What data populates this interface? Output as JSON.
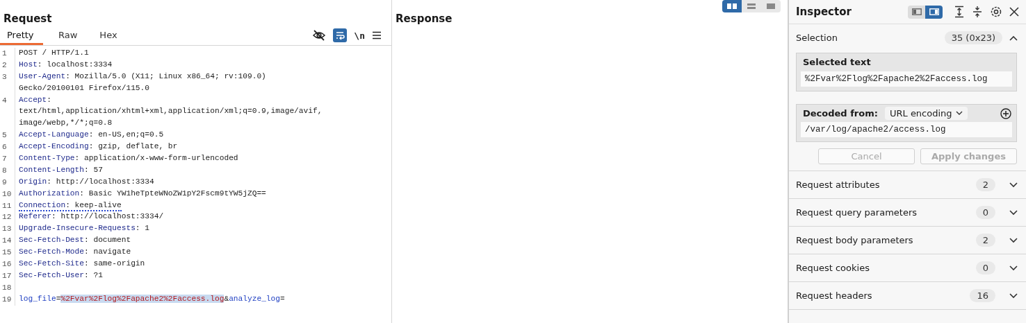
{
  "request": {
    "title": "Request",
    "tabs": [
      {
        "label": "Pretty",
        "selected": true
      },
      {
        "label": "Raw",
        "selected": false
      },
      {
        "label": "Hex",
        "selected": false
      }
    ],
    "toolbar": {
      "hide_nonprinting": false,
      "wrap_lines": true,
      "newline_label": "\\n"
    },
    "lines": [
      {
        "number": "1",
        "underlined": false,
        "segments": [
          {
            "kind": "text",
            "text": "POST / HTTP/1.1"
          }
        ]
      },
      {
        "number": "2",
        "underlined": false,
        "segments": [
          {
            "kind": "header",
            "text": "Host"
          },
          {
            "kind": "text",
            "text": ": localhost:3334"
          }
        ]
      },
      {
        "number": "3",
        "underlined": false,
        "segments": [
          {
            "kind": "header",
            "text": "User-Agent"
          },
          {
            "kind": "text",
            "text": ": Mozilla/5.0 (X11; Linux x86_64; rv:109.0)"
          }
        ]
      },
      {
        "underlined": false,
        "segments": [
          {
            "kind": "text",
            "text": "Gecko/20100101 Firefox/115.0"
          }
        ]
      },
      {
        "number": "4",
        "underlined": false,
        "segments": [
          {
            "kind": "header",
            "text": "Accept"
          },
          {
            "kind": "text",
            "text": ":"
          }
        ]
      },
      {
        "underlined": false,
        "segments": [
          {
            "kind": "text",
            "text": "text/html,application/xhtml+xml,application/xml;q=0.9,image/avif,"
          }
        ]
      },
      {
        "underlined": false,
        "segments": [
          {
            "kind": "text",
            "text": "image/webp,*/*;q=0.8"
          }
        ]
      },
      {
        "number": "5",
        "underlined": false,
        "segments": [
          {
            "kind": "header",
            "text": "Accept-Language"
          },
          {
            "kind": "text",
            "text": ": en-US,en;q=0.5"
          }
        ]
      },
      {
        "number": "6",
        "underlined": false,
        "segments": [
          {
            "kind": "header",
            "text": "Accept-Encoding"
          },
          {
            "kind": "text",
            "text": ": gzip, deflate, br"
          }
        ]
      },
      {
        "number": "7",
        "underlined": false,
        "segments": [
          {
            "kind": "header",
            "text": "Content-Type"
          },
          {
            "kind": "text",
            "text": ": application/x-www-form-urlencoded"
          }
        ]
      },
      {
        "number": "8",
        "underlined": false,
        "segments": [
          {
            "kind": "header",
            "text": "Content-Length"
          },
          {
            "kind": "text",
            "text": ": 57"
          }
        ]
      },
      {
        "number": "9",
        "underlined": false,
        "segments": [
          {
            "kind": "header",
            "text": "Origin"
          },
          {
            "kind": "text",
            "text": ": http://localhost:3334"
          }
        ]
      },
      {
        "number": "10",
        "underlined": false,
        "segments": [
          {
            "kind": "header",
            "text": "Authorization"
          },
          {
            "kind": "text",
            "text": ": Basic YW1heTpteWNoZW1pY2Fscm9tYW5jZQ=="
          }
        ]
      },
      {
        "number": "11",
        "underlined": true,
        "segments": [
          {
            "kind": "header",
            "text": "Connection"
          },
          {
            "kind": "text",
            "text": ": keep-alive"
          }
        ]
      },
      {
        "number": "12",
        "underlined": false,
        "segments": [
          {
            "kind": "header",
            "text": "Referer"
          },
          {
            "kind": "text",
            "text": ": http://localhost:3334/"
          }
        ]
      },
      {
        "number": "13",
        "underlined": false,
        "segments": [
          {
            "kind": "header",
            "text": "Upgrade-Insecure-Requests"
          },
          {
            "kind": "text",
            "text": ": 1"
          }
        ]
      },
      {
        "number": "14",
        "underlined": false,
        "segments": [
          {
            "kind": "header",
            "text": "Sec-Fetch-Dest"
          },
          {
            "kind": "text",
            "text": ": document"
          }
        ]
      },
      {
        "number": "15",
        "underlined": false,
        "segments": [
          {
            "kind": "header",
            "text": "Sec-Fetch-Mode"
          },
          {
            "kind": "text",
            "text": ": navigate"
          }
        ]
      },
      {
        "number": "16",
        "underlined": false,
        "segments": [
          {
            "kind": "header",
            "text": "Sec-Fetch-Site"
          },
          {
            "kind": "text",
            "text": ": same-origin"
          }
        ]
      },
      {
        "number": "17",
        "underlined": false,
        "segments": [
          {
            "kind": "header",
            "text": "Sec-Fetch-User"
          },
          {
            "kind": "text",
            "text": ": ?1"
          }
        ]
      },
      {
        "number": "18"
      },
      {
        "number": "19",
        "underlined": false,
        "segments": [
          {
            "kind": "param-name",
            "text": "log_file",
            "selected": false
          },
          {
            "kind": "text",
            "text": "=",
            "selected": false
          },
          {
            "kind": "param-value",
            "text": "%2Fvar%2Flog%2Fapache2%2Faccess.log",
            "selected": true
          },
          {
            "kind": "text",
            "text": "&",
            "selected": false
          },
          {
            "kind": "param-name",
            "text": "analyze_log",
            "selected": false
          },
          {
            "kind": "text",
            "text": "=",
            "selected": false
          }
        ]
      }
    ]
  },
  "response": {
    "title": "Response",
    "layouts": [
      {
        "kind": "columns",
        "selected": true
      },
      {
        "kind": "rows",
        "selected": false
      },
      {
        "kind": "single",
        "selected": false
      }
    ]
  },
  "inspector": {
    "title": "Inspector",
    "docks": [
      {
        "kind": "left",
        "selected": false
      },
      {
        "kind": "right",
        "selected": true
      }
    ],
    "selection": {
      "label": "Selection",
      "count": "35 (0x23)",
      "expanded": true,
      "selected_text": {
        "label": "Selected text",
        "value": "%2Fvar%2Flog%2Fapache2%2Faccess.log"
      },
      "decoded": {
        "label": "Decoded from:",
        "encoding": "URL encoding",
        "value": "/var/log/apache2/access.log"
      },
      "buttons": [
        {
          "label": "Cancel",
          "disabled": true
        },
        {
          "label": "Apply changes",
          "disabled": true
        }
      ]
    },
    "sections": [
      {
        "label": "Request attributes",
        "count": "2",
        "expanded": false
      },
      {
        "label": "Request query parameters",
        "count": "0",
        "expanded": false
      },
      {
        "label": "Request body parameters",
        "count": "2",
        "expanded": false
      },
      {
        "label": "Request cookies",
        "count": "0",
        "expanded": false
      },
      {
        "label": "Request headers",
        "count": "16",
        "expanded": false
      }
    ]
  }
}
